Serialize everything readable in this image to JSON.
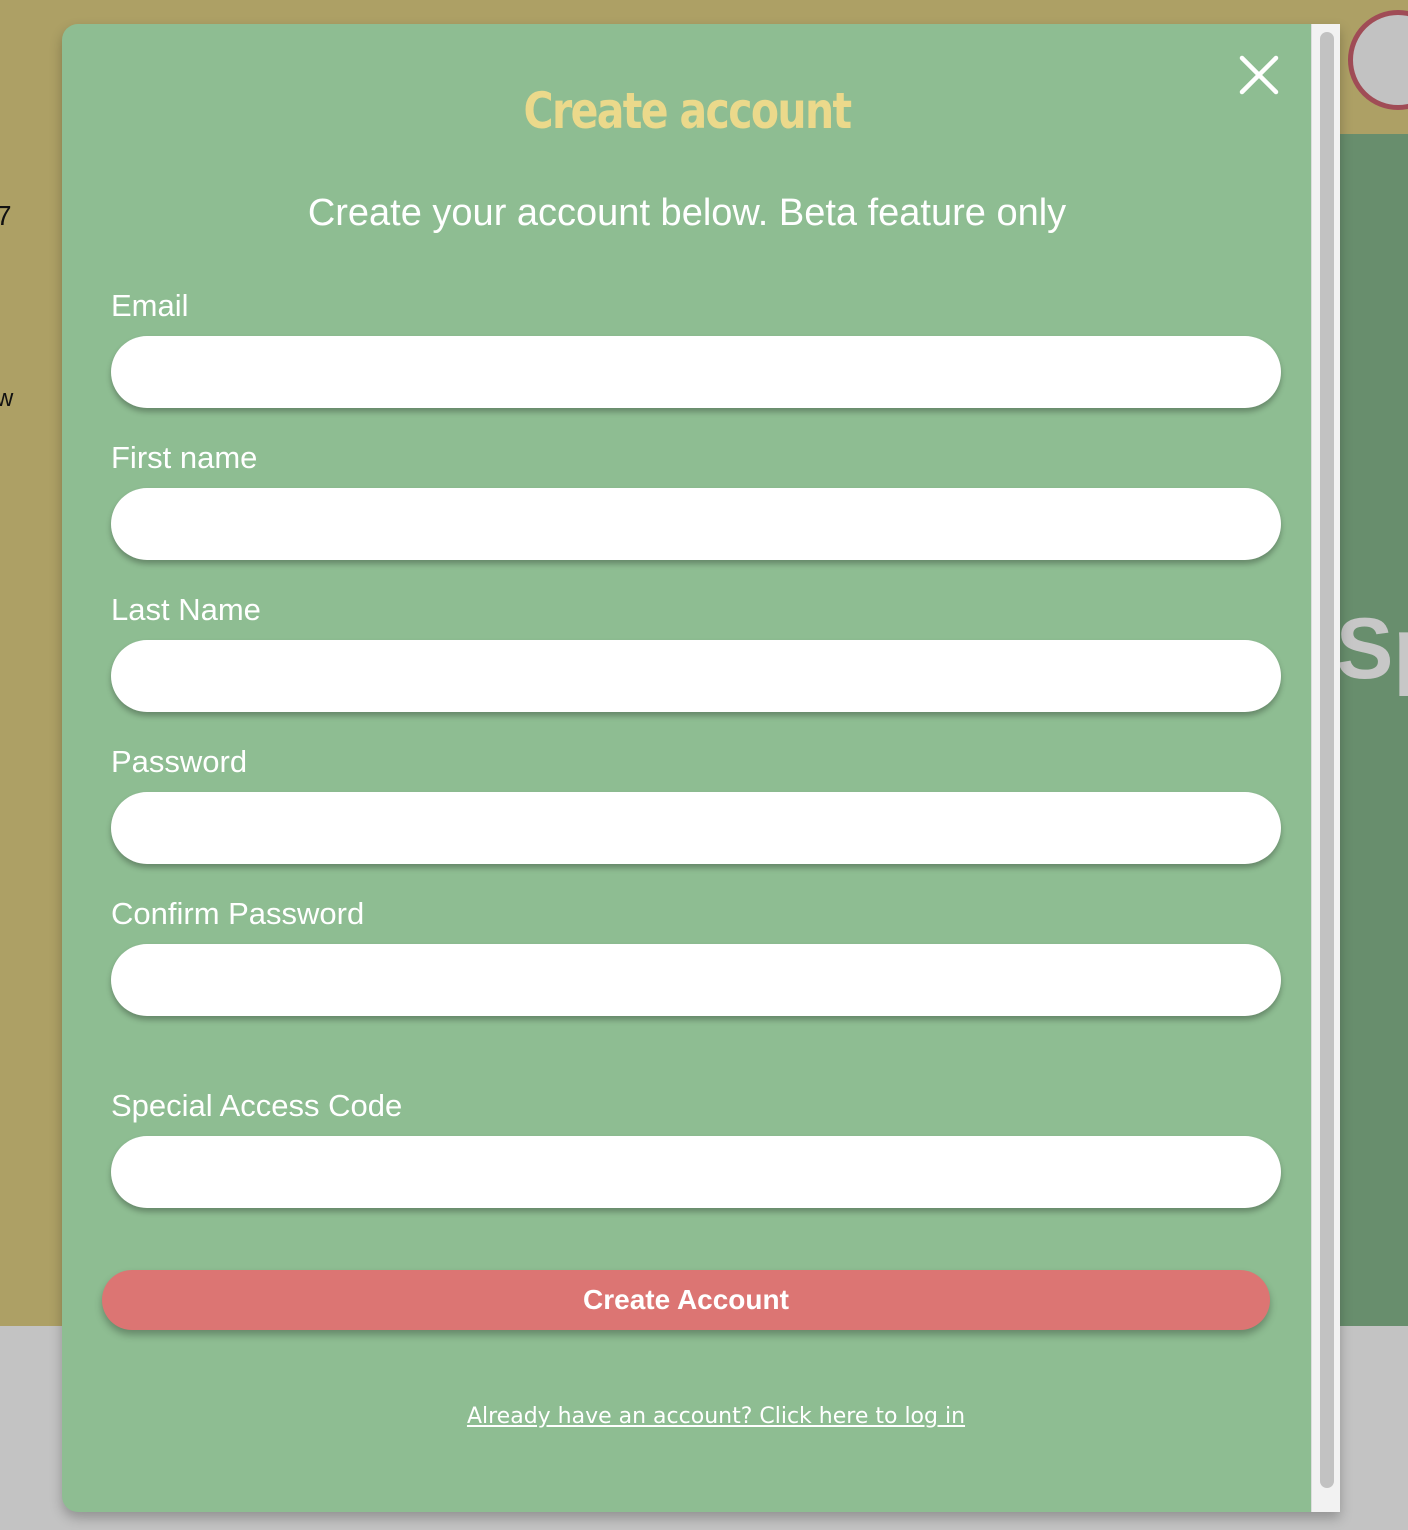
{
  "background": {
    "left_text_1": "7",
    "left_text_2": "w",
    "right_text": "Sp"
  },
  "modal": {
    "title": "Create account",
    "subtitle": "Create your account below. Beta feature only",
    "fields": [
      {
        "label": "Email",
        "value": "",
        "placeholder": ""
      },
      {
        "label": "First name",
        "value": "",
        "placeholder": ""
      },
      {
        "label": "Last Name",
        "value": "",
        "placeholder": ""
      },
      {
        "label": "Password",
        "value": "",
        "placeholder": ""
      },
      {
        "label": "Confirm Password",
        "value": "",
        "placeholder": ""
      },
      {
        "label": "Special Access Code",
        "value": "",
        "placeholder": ""
      }
    ],
    "submit_label": "Create Account",
    "login_link": "Already have an account? Click here to log in",
    "close_icon": "close-icon"
  },
  "colors": {
    "modal_bg": "#8ebd92",
    "title": "#ebd98b",
    "submit_bg": "#dc7573",
    "header_bg": "#ada065"
  }
}
